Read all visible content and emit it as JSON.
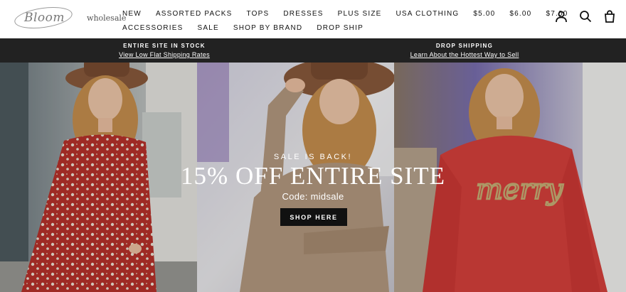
{
  "brand": {
    "script": "Bloom",
    "wordmark": "wholesale"
  },
  "nav": {
    "row1": [
      "NEW",
      "ASSORTED PACKS",
      "TOPS",
      "DRESSES",
      "PLUS SIZE",
      "USA CLOTHING",
      "$5.00",
      "$6.00",
      "$7.00"
    ],
    "row2": [
      "ACCESSORIES",
      "SALE",
      "SHOP BY BRAND",
      "DROP SHIP"
    ]
  },
  "header_icons": [
    "account-icon",
    "search-icon",
    "cart-icon"
  ],
  "announcements": [
    {
      "title": "ENTIRE SITE IN STOCK",
      "link": "View Low Flat Shipping Rates"
    },
    {
      "title": "DROP SHIPPING",
      "link": "Learn About the Hottest Way to Sell"
    }
  ],
  "hero": {
    "eyebrow": "SALE IS BACK!",
    "headline": "15% OFF ENTIRE SITE",
    "code": "Code: midsale",
    "cta": "SHOP HERE",
    "sweater_text": "merry"
  },
  "colors": {
    "header_bg": "#ffffff",
    "announce_bg": "#222222",
    "cta_bg": "#111111",
    "red_dress": "#b8312a",
    "red_sweater": "#d8403c",
    "tan_sweater": "#b59a80",
    "hat": "#8a5a3c"
  }
}
